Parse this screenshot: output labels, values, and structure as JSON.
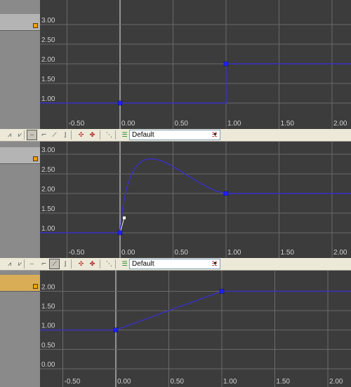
{
  "toolbar": {
    "preset_value": "Default",
    "buttons": [
      "flatten-tangents-icon",
      "linear-tangents-icon",
      "smooth-tangents-icon",
      "free-tangent-icon",
      "linear-tangent-icon",
      "stepped-tangent-icon",
      "break-tangents-icon",
      "unify-tangents-icon",
      "snap-keys-icon",
      "fit-view-icon",
      "delete-preset-icon"
    ]
  },
  "panels": [
    {
      "active_tangent": "",
      "slot_selected": false,
      "x_ticks": [
        "-0.50",
        "0.00",
        "0.50",
        "1.00",
        "1.50",
        "2.00"
      ],
      "y_ticks": [
        "1.00",
        "1.50",
        "2.00",
        "2.50",
        "3.00"
      ],
      "curve": "stepped",
      "keys": [
        {
          "x": 0.0,
          "y": 1.0
        },
        {
          "x": 1.0,
          "y": 2.0
        }
      ]
    },
    {
      "active_tangent": "smooth",
      "slot_selected": false,
      "x_ticks": [
        "-0.50",
        "0.00",
        "0.50",
        "1.00",
        "1.50",
        "2.00"
      ],
      "y_ticks": [
        "1.00",
        "1.50",
        "2.00",
        "2.50",
        "3.00"
      ],
      "curve": "bezier",
      "keys": [
        {
          "x": 0.0,
          "y": 1.0
        },
        {
          "x": 1.0,
          "y": 2.0
        }
      ]
    },
    {
      "active_tangent": "linear",
      "slot_selected": true,
      "x_ticks": [
        "-0.50",
        "0.00",
        "0.50",
        "1.00",
        "1.50",
        "2.00"
      ],
      "y_ticks": [
        "0.00",
        "0.50",
        "1.00",
        "1.50",
        "2.00"
      ],
      "curve": "linear",
      "keys": [
        {
          "x": 0.0,
          "y": 1.0
        },
        {
          "x": 1.0,
          "y": 2.0
        }
      ]
    }
  ],
  "colors": {
    "curve": "#3a30c8",
    "key": "#2020ff",
    "grid": "#6a6a6a",
    "background": "#3c3c3c",
    "origin_line": "#e8e8e8",
    "selected_slot": "#d9ad55"
  }
}
